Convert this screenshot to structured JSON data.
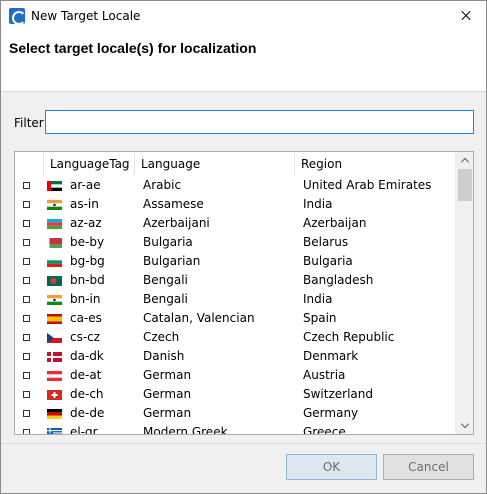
{
  "window": {
    "title": "New Target Locale"
  },
  "header": {
    "title": "Select target locale(s) for localization"
  },
  "filter": {
    "label": "Filter",
    "value": "",
    "placeholder": ""
  },
  "table": {
    "columns": [
      "",
      "LanguageTag",
      "Language",
      "Region"
    ],
    "rows": [
      {
        "tag": "ar-ae",
        "language": "Arabic",
        "region": "United Arab Emirates",
        "flag": "flag-uae-icon",
        "checked": false
      },
      {
        "tag": "as-in",
        "language": "Assamese",
        "region": "India",
        "flag": "flag-india-icon",
        "checked": false
      },
      {
        "tag": "az-az",
        "language": "Azerbaijani",
        "region": "Azerbaijan",
        "flag": "flag-azerbaijan-icon",
        "checked": false
      },
      {
        "tag": "be-by",
        "language": "Bulgaria",
        "region": "Belarus",
        "flag": "flag-belarus-icon",
        "checked": false
      },
      {
        "tag": "bg-bg",
        "language": "Bulgarian",
        "region": "Bulgaria",
        "flag": "flag-bulgaria-icon",
        "checked": false
      },
      {
        "tag": "bn-bd",
        "language": "Bengali",
        "region": "Bangladesh",
        "flag": "flag-bangladesh-icon",
        "checked": false
      },
      {
        "tag": "bn-in",
        "language": "Bengali",
        "region": "India",
        "flag": "flag-india-icon",
        "checked": false
      },
      {
        "tag": "ca-es",
        "language": "Catalan, Valencian",
        "region": "Spain",
        "flag": "flag-spain-icon",
        "checked": false
      },
      {
        "tag": "cs-cz",
        "language": "Czech",
        "region": "Czech Republic",
        "flag": "flag-czech-icon",
        "checked": false
      },
      {
        "tag": "da-dk",
        "language": "Danish",
        "region": "Denmark",
        "flag": "flag-denmark-icon",
        "checked": false
      },
      {
        "tag": "de-at",
        "language": "German",
        "region": "Austria",
        "flag": "flag-austria-icon",
        "checked": false
      },
      {
        "tag": "de-ch",
        "language": "German",
        "region": "Switzerland",
        "flag": "flag-switzerland-icon",
        "checked": false
      },
      {
        "tag": "de-de",
        "language": "German",
        "region": "Germany",
        "flag": "flag-germany-icon",
        "checked": false
      },
      {
        "tag": "el-gr",
        "language": "Modern Greek",
        "region": "Greece",
        "flag": "flag-greece-icon",
        "checked": false
      }
    ]
  },
  "buttons": {
    "ok": "OK",
    "cancel": "Cancel"
  },
  "colors": {
    "accent": "#1a8ad4",
    "ok_bg": "#dde7f1",
    "button_text_disabled": "#6d6d6d"
  }
}
